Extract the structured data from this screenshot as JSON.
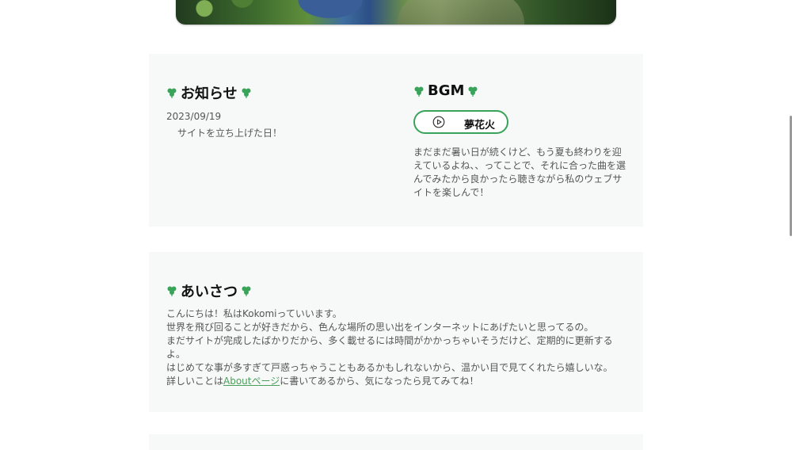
{
  "news": {
    "heading": "お知らせ",
    "date": "2023/09/19",
    "text": "サイトを立ち上げた日！"
  },
  "bgm": {
    "heading": "BGM",
    "button_label": "夢花火",
    "description": "まだまだ暑い日が続くけど、もう夏も終わりを迎えているよね、、ってことで、それに合った曲を選んでみたから良かったら聴きながら私のウェブサイトを楽しんで！"
  },
  "greeting": {
    "heading": "あいさつ",
    "line1": "こんにちは！私はKokomiっていいます。",
    "line2": "世界を飛び回ることが好きだから、色んな場所の思い出をインターネットにあげたいと思ってるの。",
    "line3": "まだサイトが完成したばかりだから、多く載せるには時間がかかっちゃいそうだけど、定期的に更新するよ。",
    "line4": "はじめてな事が多すぎて戸惑っちゃうこともあるかもしれないから、温かい目で見てくれたら嬉しいな。",
    "line5_pre": "詳しいことは",
    "line5_link": "Aboutページ",
    "line5_post": "に書いてあるから、気になったら見てみてね！"
  },
  "colors": {
    "accent": "#3aa35a",
    "card_bg": "#f6f9f8"
  },
  "icons": {
    "clover": "clover-icon",
    "play": "play-circle-icon"
  }
}
